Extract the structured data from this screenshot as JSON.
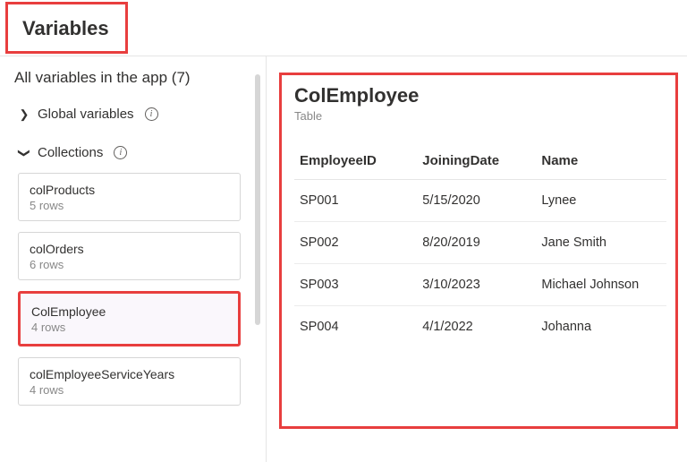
{
  "title": "Variables",
  "subtitle_prefix": "All variables in the app",
  "total_count": "(7)",
  "sections": {
    "global": {
      "label": "Global variables"
    },
    "collections": {
      "label": "Collections"
    }
  },
  "collections": [
    {
      "name": "colProducts",
      "meta": "5 rows"
    },
    {
      "name": "colOrders",
      "meta": "6 rows"
    },
    {
      "name": "ColEmployee",
      "meta": "4 rows"
    },
    {
      "name": "colEmployeeServiceYears",
      "meta": "4 rows"
    }
  ],
  "detail": {
    "name": "ColEmployee",
    "type": "Table",
    "columns": [
      "EmployeeID",
      "JoiningDate",
      "Name"
    ],
    "rows": [
      [
        "SP001",
        "5/15/2020",
        "Lynee"
      ],
      [
        "SP002",
        "8/20/2019",
        "Jane Smith"
      ],
      [
        "SP003",
        "3/10/2023",
        "Michael Johnson"
      ],
      [
        "SP004",
        "4/1/2022",
        "Johanna"
      ]
    ]
  }
}
